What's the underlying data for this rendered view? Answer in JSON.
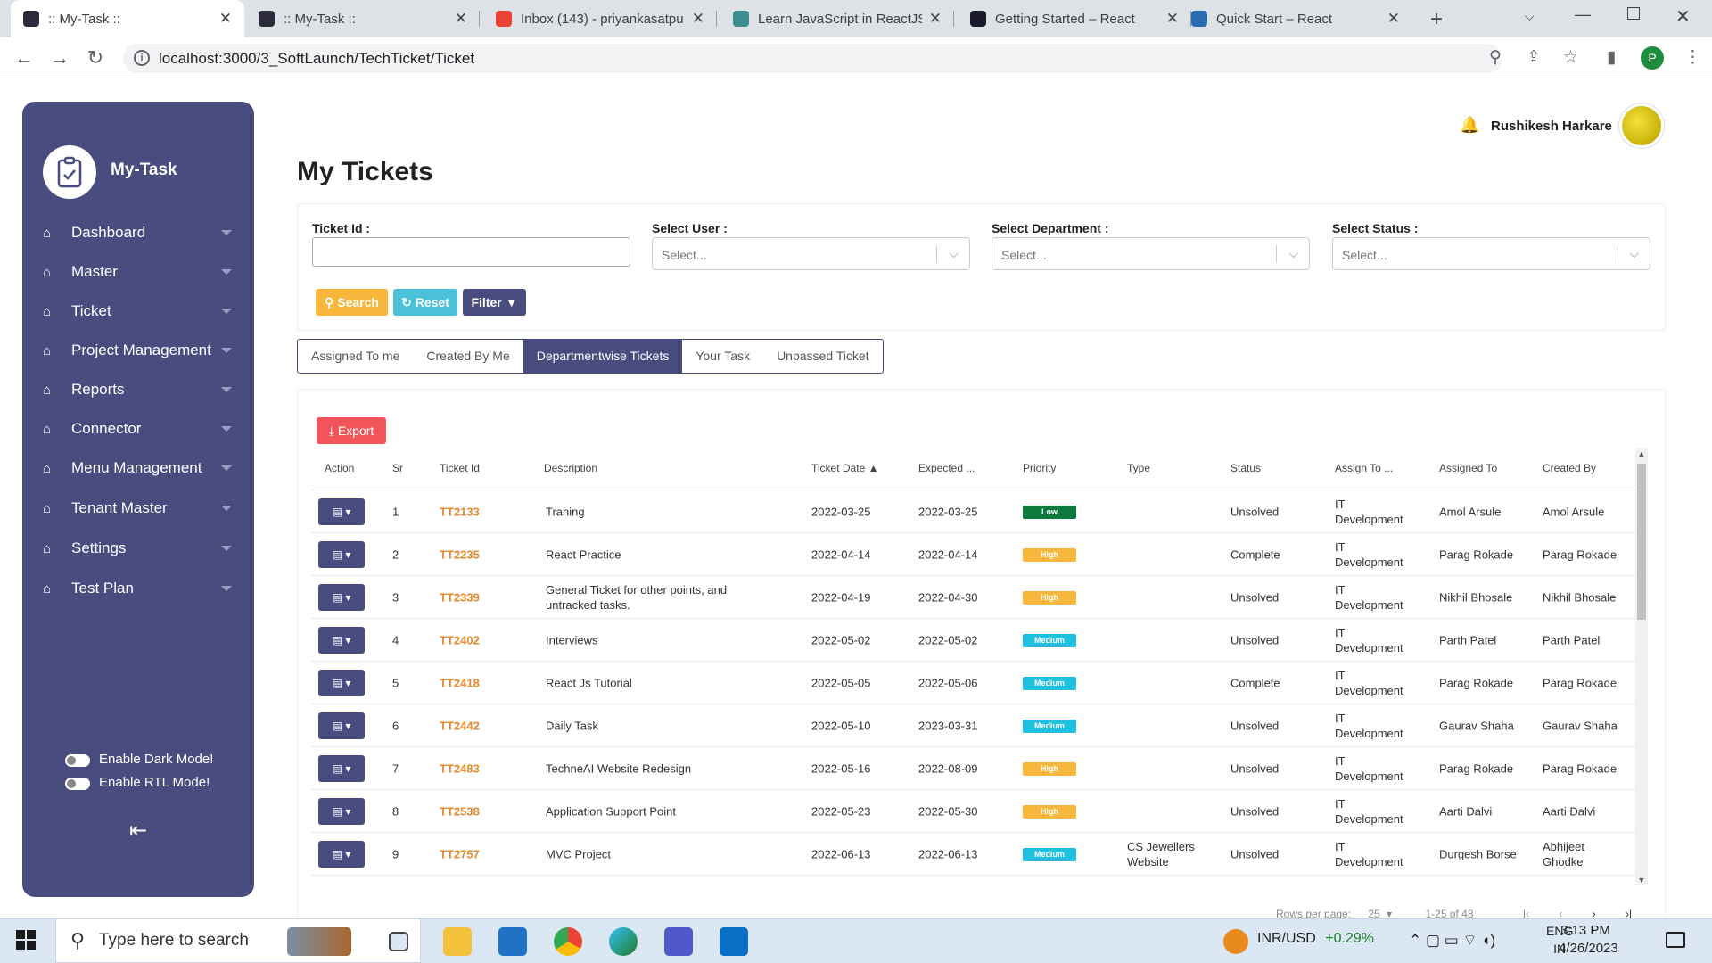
{
  "browser": {
    "tabs": [
      {
        "title": ":: My-Task ::",
        "active": true
      },
      {
        "title": ":: My-Task ::",
        "active": false
      },
      {
        "title": "Inbox (143) - priyankasatpu",
        "active": false
      },
      {
        "title": "Learn JavaScript in ReactJS.",
        "active": false
      },
      {
        "title": "Getting Started – React",
        "active": false
      },
      {
        "title": "Quick Start – React",
        "active": false
      }
    ],
    "url": "localhost:3000/3_SoftLaunch/TechTicket/Ticket",
    "profile_initial": "P"
  },
  "sidebar": {
    "brand": "My-Task",
    "items": [
      {
        "label": "Dashboard"
      },
      {
        "label": "Master"
      },
      {
        "label": "Ticket"
      },
      {
        "label": "Project Management"
      },
      {
        "label": "Reports"
      },
      {
        "label": "Connector"
      },
      {
        "label": "Menu Management"
      },
      {
        "label": "Tenant Master"
      },
      {
        "label": "Settings"
      },
      {
        "label": "Test Plan"
      }
    ],
    "dark_mode_label": "Enable Dark Mode!",
    "rtl_mode_label": "Enable RTL Mode!"
  },
  "header": {
    "user_name": "Rushikesh Harkare"
  },
  "page": {
    "title": "My Tickets"
  },
  "filters": {
    "ticket_id_label": "Ticket Id :",
    "user_label": "Select User :",
    "department_label": "Select Department :",
    "status_label": "Select Status :",
    "select_placeholder": "Select...",
    "search_label": "Search",
    "reset_label": "Reset",
    "filter_label": "Filter"
  },
  "tabs": [
    {
      "label": "Assigned To me",
      "active": false
    },
    {
      "label": "Created By Me",
      "active": false
    },
    {
      "label": "Departmentwise Tickets",
      "active": true
    },
    {
      "label": "Your Task",
      "active": false
    },
    {
      "label": "Unpassed Ticket",
      "active": false
    }
  ],
  "table": {
    "export_label": "Export",
    "headers": [
      "Action",
      "Sr",
      "Ticket Id",
      "Description",
      "Ticket Date ▲",
      "Expected ...",
      "Priority",
      "Type",
      "Status",
      "Assign To ...",
      "Assigned To",
      "Created By"
    ],
    "rows": [
      {
        "sr": "1",
        "id": "TT2133",
        "desc": "Traning",
        "date": "2022-03-25",
        "expected": "2022-03-25",
        "priority": "Low",
        "type": "",
        "status": "Unsolved",
        "assign_to": "IT Development",
        "assigned": "Amol Arsule",
        "created": "Amol Arsule"
      },
      {
        "sr": "2",
        "id": "TT2235",
        "desc": "React Practice",
        "date": "2022-04-14",
        "expected": "2022-04-14",
        "priority": "High",
        "type": "",
        "status": "Complete",
        "assign_to": "IT Development",
        "assigned": "Parag Rokade",
        "created": "Parag Rokade"
      },
      {
        "sr": "3",
        "id": "TT2339",
        "desc": "General Ticket for other points, and untracked tasks.",
        "date": "2022-04-19",
        "expected": "2022-04-30",
        "priority": "High",
        "type": "",
        "status": "Unsolved",
        "assign_to": "IT Development",
        "assigned": "Nikhil Bhosale",
        "created": "Nikhil Bhosale"
      },
      {
        "sr": "4",
        "id": "TT2402",
        "desc": "Interviews",
        "date": "2022-05-02",
        "expected": "2022-05-02",
        "priority": "Medium",
        "type": "",
        "status": "Unsolved",
        "assign_to": "IT Development",
        "assigned": "Parth Patel",
        "created": "Parth Patel"
      },
      {
        "sr": "5",
        "id": "TT2418",
        "desc": "React Js Tutorial",
        "date": "2022-05-05",
        "expected": "2022-05-06",
        "priority": "Medium",
        "type": "",
        "status": "Complete",
        "assign_to": "IT Development",
        "assigned": "Parag Rokade",
        "created": "Parag Rokade"
      },
      {
        "sr": "6",
        "id": "TT2442",
        "desc": "Daily Task",
        "date": "2022-05-10",
        "expected": "2023-03-31",
        "priority": "Medium",
        "type": "",
        "status": "Unsolved",
        "assign_to": "IT Development",
        "assigned": "Gaurav Shaha",
        "created": "Gaurav Shaha"
      },
      {
        "sr": "7",
        "id": "TT2483",
        "desc": "TechneAI Website Redesign",
        "date": "2022-05-16",
        "expected": "2022-08-09",
        "priority": "High",
        "type": "",
        "status": "Unsolved",
        "assign_to": "IT Development",
        "assigned": "Parag Rokade",
        "created": "Parag Rokade"
      },
      {
        "sr": "8",
        "id": "TT2538",
        "desc": "Application Support Point",
        "date": "2022-05-23",
        "expected": "2022-05-30",
        "priority": "High",
        "type": "",
        "status": "Unsolved",
        "assign_to": "IT Development",
        "assigned": "Aarti Dalvi",
        "created": "Aarti Dalvi"
      },
      {
        "sr": "9",
        "id": "TT2757",
        "desc": "MVC Project",
        "date": "2022-06-13",
        "expected": "2022-06-13",
        "priority": "Medium",
        "type": "CS Jewellers Website",
        "status": "Unsolved",
        "assign_to": "IT Development",
        "assigned": "Durgesh Borse",
        "created": "Abhijeet Ghodke"
      }
    ],
    "pagination": {
      "rows_per_page_label": "Rows per page:",
      "rows_per_page": "25",
      "range": "1-25 of 48"
    }
  },
  "colors": {
    "sidebar": "#484c7f",
    "low": "#0c7a3d",
    "high": "#f6b73c",
    "medium": "#22c0e0",
    "ticket_id": "#e9892b"
  },
  "taskbar": {
    "search_placeholder": "Type here to search",
    "currency": "INR/USD",
    "currency_change": "+0.29%",
    "lang_1": "ENG",
    "lang_2": "IN",
    "time": "3:13 PM",
    "date": "4/26/2023"
  }
}
